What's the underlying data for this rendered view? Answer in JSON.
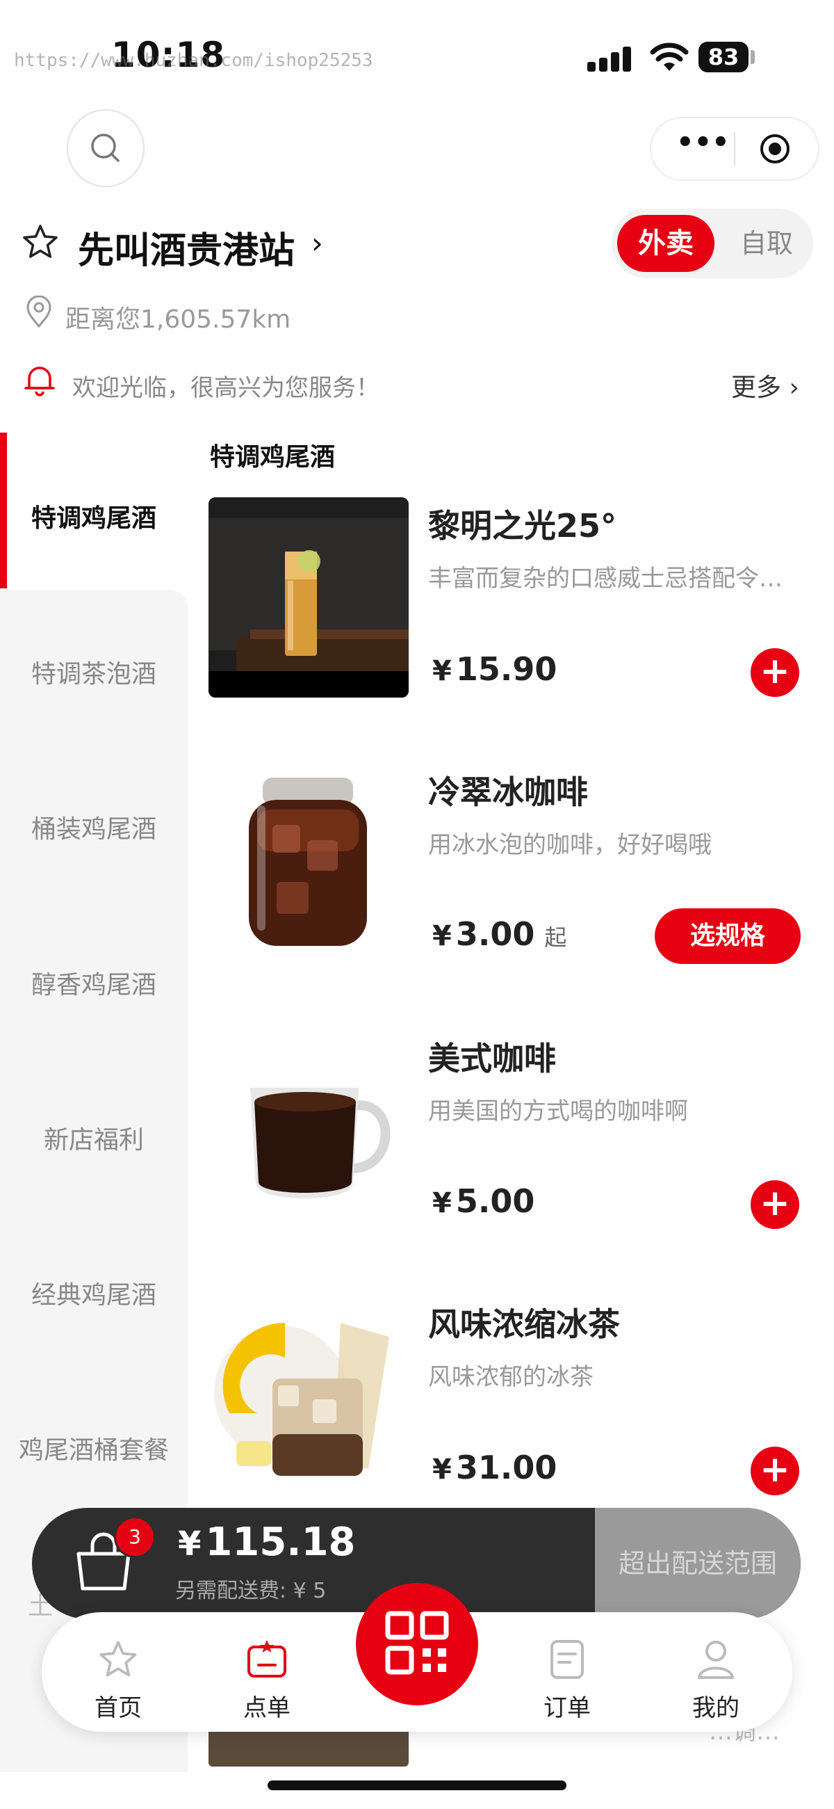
{
  "status_bar": {
    "time": "10:18",
    "watermark": "https://www.huzhan.com/ishop25253",
    "battery": "83"
  },
  "header": {
    "more_label": "•••"
  },
  "store": {
    "name": "先叫酒贵港站",
    "distance": "距离您1,605.57km",
    "notice": "欢迎光临，很高兴为您服务！",
    "notice_more": "更多 ›",
    "modes": [
      "外卖",
      "自取"
    ]
  },
  "sidebar": {
    "items": [
      "特调鸡尾酒",
      "特调茶泡酒",
      "桶装鸡尾酒",
      "醇香鸡尾酒",
      "新店福利",
      "经典鸡尾酒",
      "鸡尾酒桶套餐",
      "土"
    ]
  },
  "section_title": "特调鸡尾酒",
  "products": [
    {
      "name": "黎明之光25°",
      "desc": "丰富而复杂的口感威士忌搭配令…",
      "currency": "¥",
      "price": "15.90"
    },
    {
      "name": "冷翠冰咖啡",
      "desc": "用冰水泡的咖啡，好好喝哦",
      "currency": "¥",
      "price": "3.00",
      "suffix": "起",
      "action": "选规格"
    },
    {
      "name": "美式咖啡",
      "desc": "用美国的方式喝的咖啡啊",
      "currency": "¥",
      "price": "5.00"
    },
    {
      "name": "风味浓缩冰茶",
      "desc": "风味浓郁的冰茶",
      "currency": "¥",
      "price": "31.00"
    }
  ],
  "add_symbol": "+",
  "partial_desc": "…调…",
  "cart": {
    "count": "3",
    "currency": "¥",
    "total": "115.18",
    "delivery_fee": "另需配送费: ¥ 5",
    "status": "超出配送范围"
  },
  "tabbar": {
    "items": [
      "首页",
      "点单",
      "订单",
      "我的"
    ]
  },
  "colors": {
    "accent": "#e60012",
    "cart_bg": "#2e2e2e"
  }
}
